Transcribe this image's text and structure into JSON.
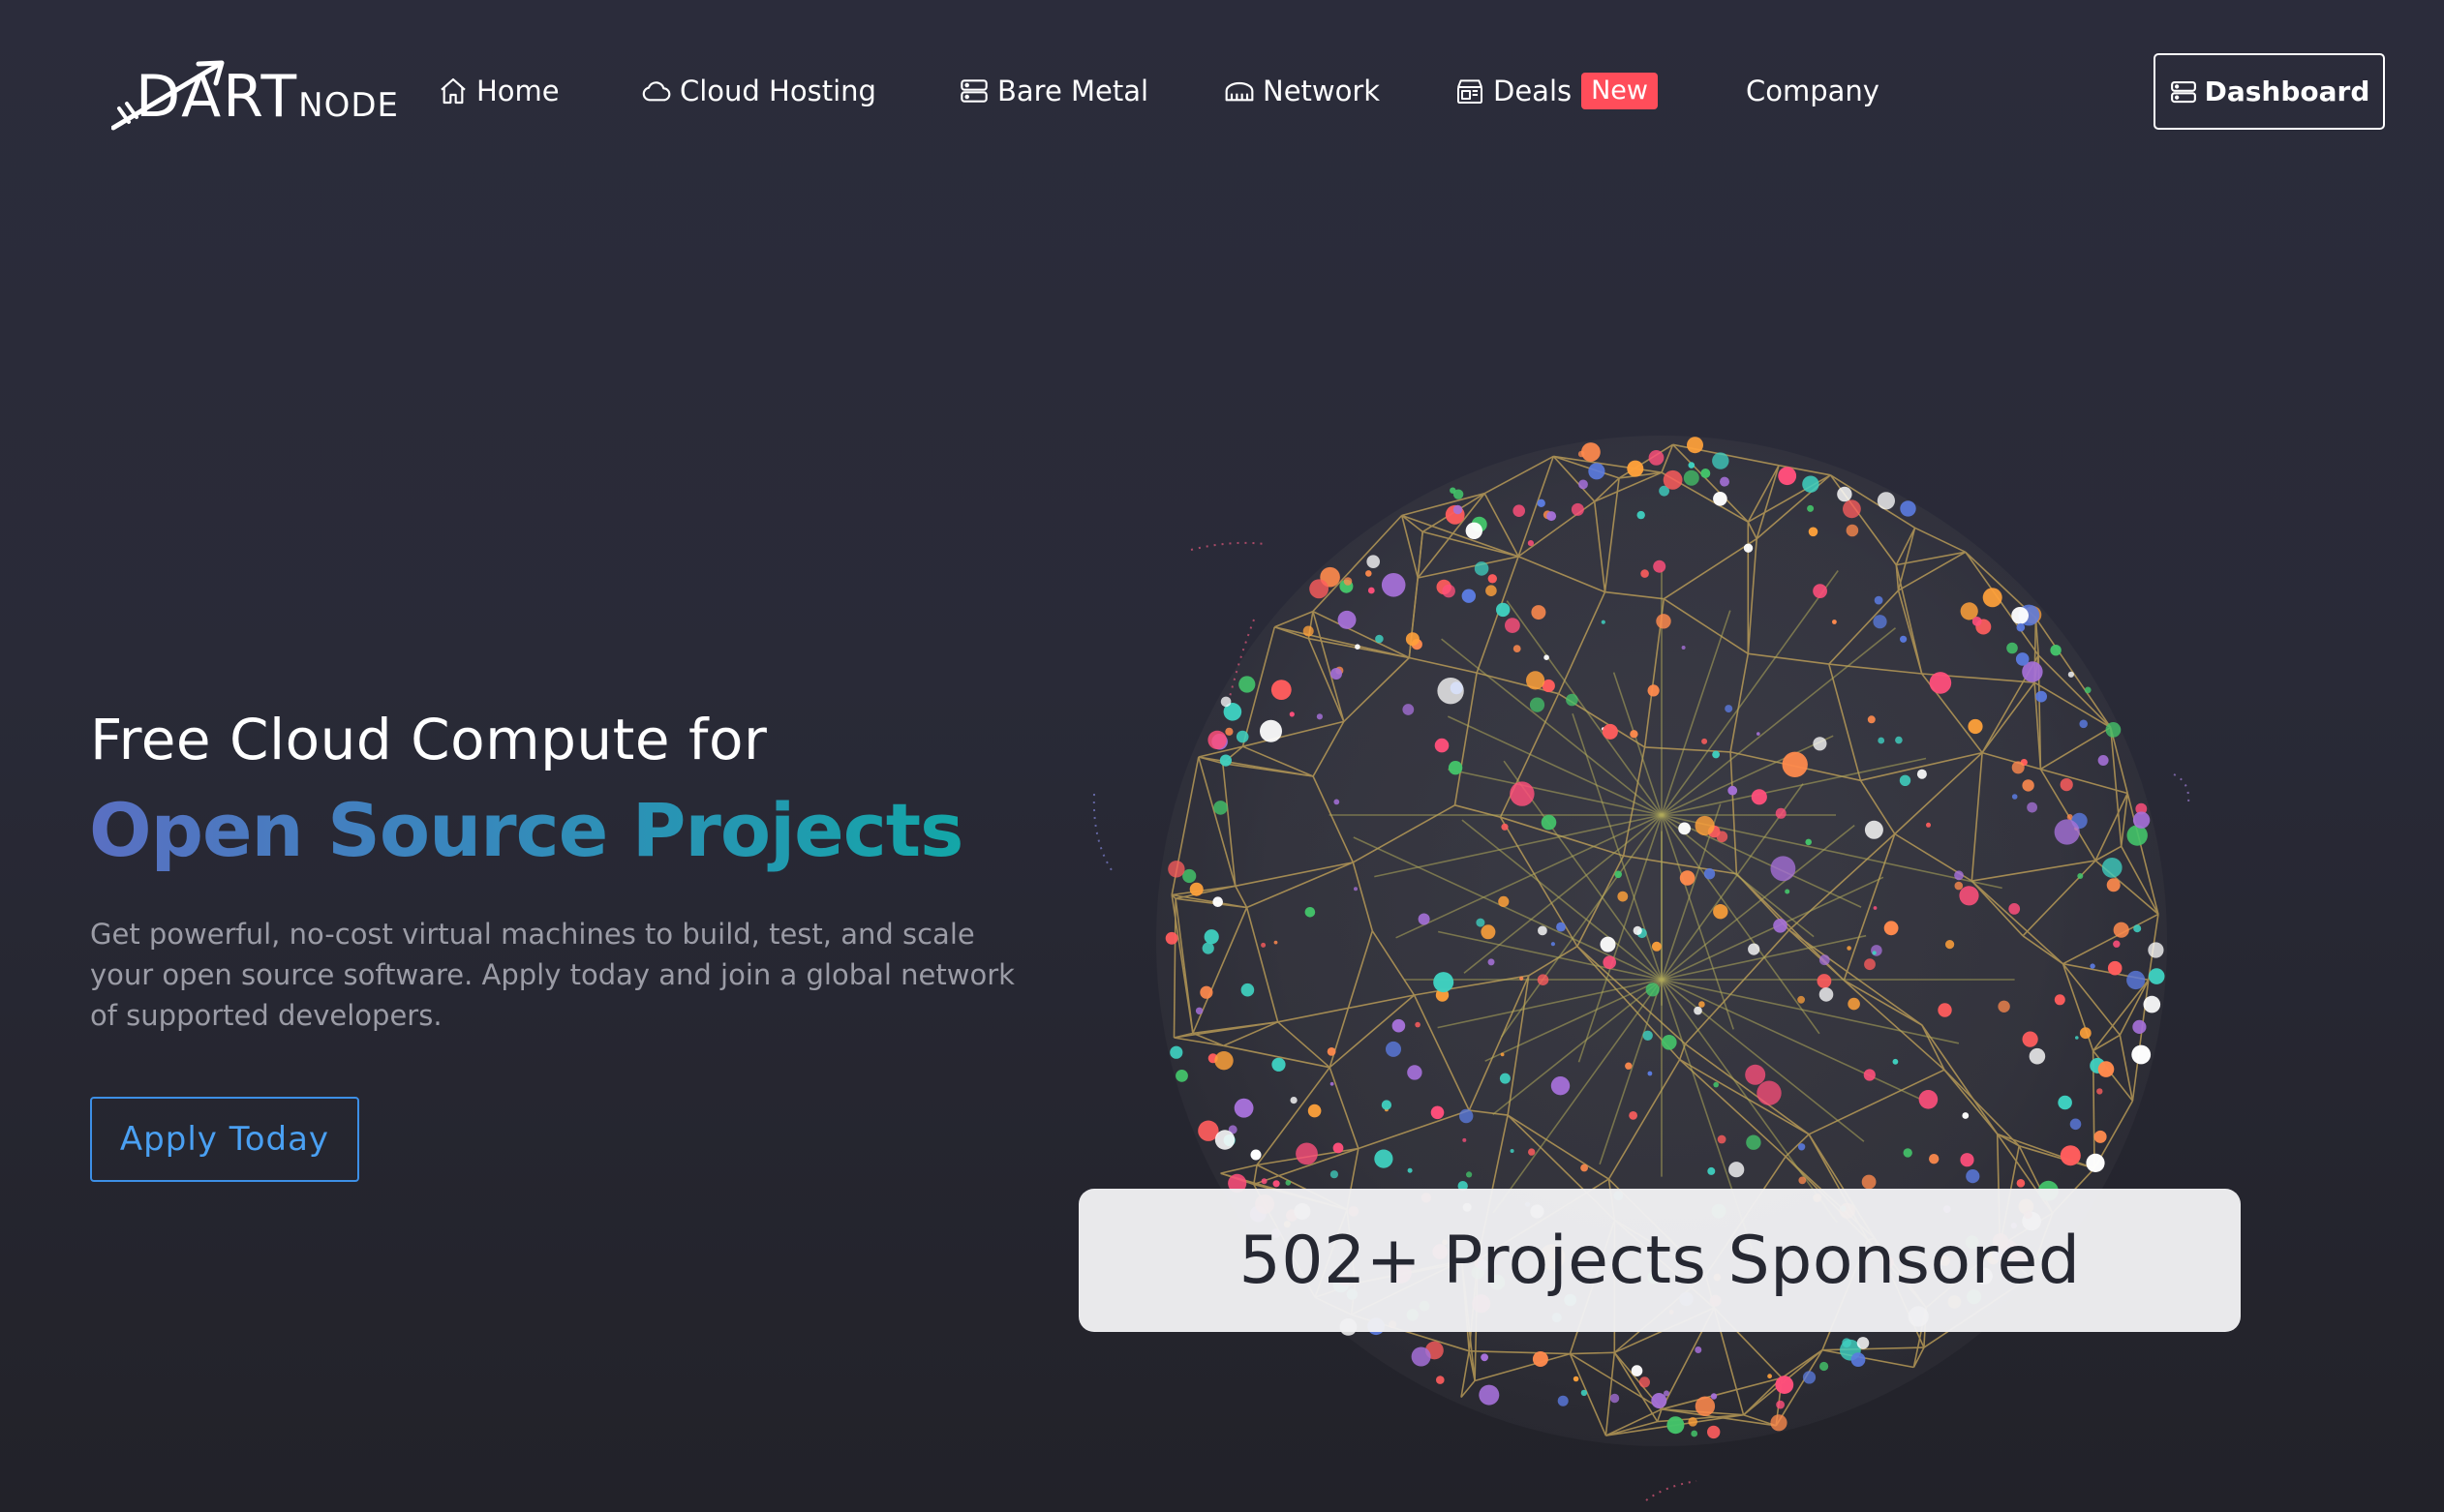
{
  "brand": {
    "logo_big": "DART",
    "logo_small": "NODE"
  },
  "nav": {
    "items": [
      {
        "label": "Home",
        "icon": "home-icon"
      },
      {
        "label": "Cloud Hosting",
        "icon": "cloud-icon"
      },
      {
        "label": "Bare Metal",
        "icon": "server-icon"
      },
      {
        "label": "Network",
        "icon": "network-icon"
      },
      {
        "label": "Deals",
        "icon": "deals-icon",
        "badge": "New"
      },
      {
        "label": "Company"
      }
    ],
    "dashboard_label": "Dashboard"
  },
  "hero": {
    "pre_title": "Free Cloud Compute for",
    "title": "Open Source Projects",
    "description": "Get powerful, no-cost virtual machines to build, test, and scale your open source software. Apply today and join a global network of supported developers.",
    "cta_label": "Apply Today"
  },
  "stats": {
    "projects_sponsored": "502+ Projects Sponsored"
  },
  "colors": {
    "background": "#2a2b38",
    "accent_blue": "#4aa0f2",
    "badge_red": "#ff4d5a",
    "title_gradient_start": "#5a6fc2",
    "title_gradient_end": "#13a6a7",
    "globe_lines": "#c8a75a"
  }
}
